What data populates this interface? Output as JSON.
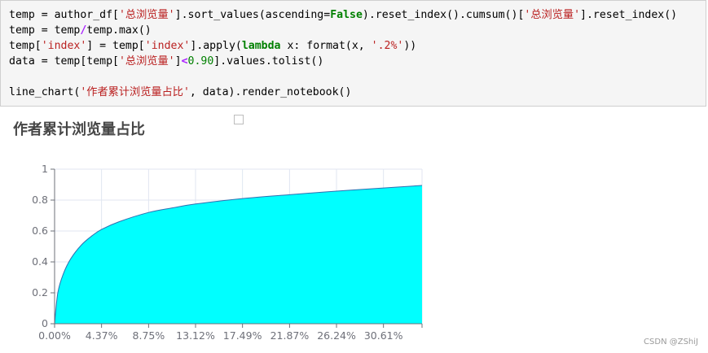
{
  "code_cell": {
    "lines": [
      [
        {
          "t": "plain",
          "s": "temp = author_df["
        },
        {
          "t": "str",
          "s": "'总浏览量'"
        },
        {
          "t": "plain",
          "s": "].sort_values(ascending="
        },
        {
          "t": "kw",
          "s": "False"
        },
        {
          "t": "plain",
          "s": ").reset_index().cumsum()["
        },
        {
          "t": "str",
          "s": "'总浏览量'"
        },
        {
          "t": "plain",
          "s": "].reset_index()"
        }
      ],
      [
        {
          "t": "plain",
          "s": "temp = temp"
        },
        {
          "t": "op",
          "s": "/"
        },
        {
          "t": "plain",
          "s": "temp.max()"
        }
      ],
      [
        {
          "t": "plain",
          "s": "temp["
        },
        {
          "t": "str",
          "s": "'index'"
        },
        {
          "t": "plain",
          "s": "] = temp["
        },
        {
          "t": "str",
          "s": "'index'"
        },
        {
          "t": "plain",
          "s": "].apply("
        },
        {
          "t": "kw",
          "s": "lambda"
        },
        {
          "t": "plain",
          "s": " x: format(x, "
        },
        {
          "t": "str",
          "s": "'.2%'"
        },
        {
          "t": "plain",
          "s": "))"
        }
      ],
      [
        {
          "t": "plain",
          "s": "data = temp[temp["
        },
        {
          "t": "str",
          "s": "'总浏览量'"
        },
        {
          "t": "plain",
          "s": "]"
        },
        {
          "t": "op",
          "s": "<"
        },
        {
          "t": "num",
          "s": "0.90"
        },
        {
          "t": "plain",
          "s": "].values.tolist()"
        }
      ],
      [],
      [
        {
          "t": "plain",
          "s": "line_chart("
        },
        {
          "t": "str",
          "s": "'作者累计浏览量占比'"
        },
        {
          "t": "plain",
          "s": ", data).render_notebook()"
        }
      ]
    ]
  },
  "chart_data": {
    "type": "area",
    "title": "作者累计浏览量占比",
    "x_tick_labels": [
      "0.00%",
      "4.37%",
      "8.75%",
      "13.12%",
      "17.49%",
      "21.87%",
      "26.24%",
      "30.61%"
    ],
    "x_max_percent": 34.2,
    "y_ticks": [
      0,
      0.2,
      0.4,
      0.6,
      0.8,
      1
    ],
    "y_tick_labels": [
      "0",
      "0.2",
      "0.4",
      "0.6",
      "0.8",
      "1"
    ],
    "ylim": [
      0,
      1
    ],
    "grid": true,
    "series": [
      {
        "fill_color": "#00ffff",
        "line_color": "#2f6fb0",
        "x": [
          0,
          0.3,
          0.8,
          1.5,
          2.5,
          3.5,
          4.37,
          6,
          8.75,
          11,
          13.12,
          17.49,
          21.87,
          26.24,
          30.61,
          34.2
        ],
        "y": [
          0,
          0.2,
          0.32,
          0.42,
          0.51,
          0.57,
          0.61,
          0.66,
          0.72,
          0.75,
          0.775,
          0.81,
          0.835,
          0.858,
          0.878,
          0.895
        ]
      }
    ]
  },
  "watermark": "CSDN @ZShiJ"
}
